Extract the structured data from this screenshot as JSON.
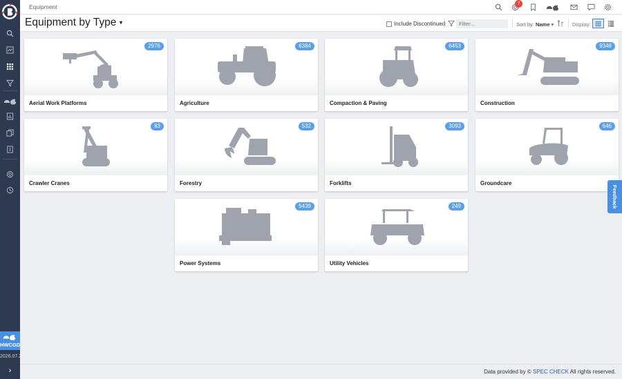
{
  "sidebar": {
    "bottom_label": "HWCGD",
    "version": "2026.07.2"
  },
  "topbar": {
    "breadcrumb": "Equipment",
    "notification_count": "7"
  },
  "header": {
    "title": "Equipment by Type",
    "include_discontinued_label": "Include Discontinued",
    "filter_placeholder": "Filter...",
    "sort_label": "Sort by:",
    "sort_value": "Name",
    "display_label": "Display:"
  },
  "cards": [
    {
      "label": "Aerial Work Platforms",
      "count": "2976"
    },
    {
      "label": "Agriculture",
      "count": "6384"
    },
    {
      "label": "Compaction & Paving",
      "count": "6453"
    },
    {
      "label": "Construction",
      "count": "9348"
    },
    {
      "label": "Crawler Cranes",
      "count": "83"
    },
    {
      "label": "Forestry",
      "count": "532"
    },
    {
      "label": "Forklifts",
      "count": "3093"
    },
    {
      "label": "Groundcare",
      "count": "646"
    },
    {
      "label": "Power Systems",
      "count": "5439"
    },
    {
      "label": "Utility Vehicles",
      "count": "249"
    }
  ],
  "feedback_label": "Feedback",
  "footer": {
    "prefix": "Data provided by ©",
    "link": "SPEC CHECK",
    "suffix": "All rights reserved."
  },
  "colors": {
    "sidebar": "#2e3a4f",
    "accent": "#4a90e2",
    "badge": "#5b9fe8",
    "silhouette": "#9ea3ad"
  }
}
